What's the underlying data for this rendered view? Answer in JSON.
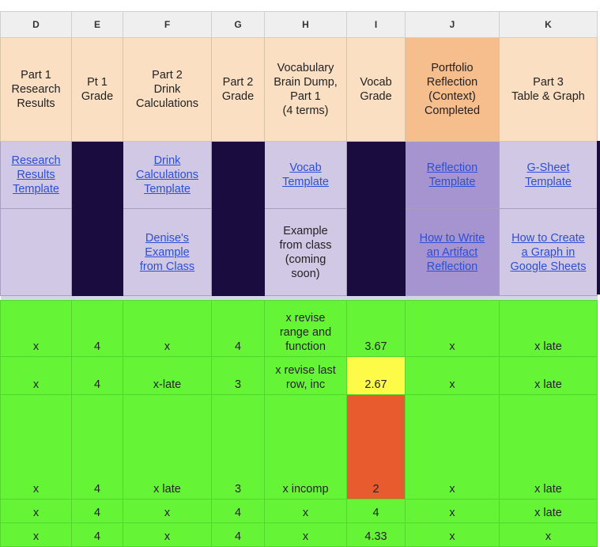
{
  "columns": [
    "D",
    "E",
    "F",
    "G",
    "H",
    "I",
    "J",
    "K"
  ],
  "headers": [
    [
      "Part 1",
      "Research",
      "Results"
    ],
    [
      "Pt 1",
      "Grade"
    ],
    [
      "Part 2",
      "Drink",
      "Calculations"
    ],
    [
      "Part 2",
      "Grade"
    ],
    [
      "Vocabulary",
      "Brain Dump,",
      "Part 1",
      "(4 terms)"
    ],
    [
      "Vocab",
      "Grade"
    ],
    [
      "Portfolio",
      "Reflection",
      "(Context)",
      "Completed"
    ],
    [
      "Part 3",
      "Table & Graph"
    ]
  ],
  "links_row": [
    {
      "type": "link",
      "lines": [
        "Research",
        "Results",
        "Template"
      ]
    },
    {
      "type": "blank"
    },
    {
      "type": "link",
      "lines": [
        "Drink",
        "Calculations",
        "Template"
      ]
    },
    {
      "type": "blank"
    },
    {
      "type": "link",
      "lines": [
        "Vocab",
        "Template"
      ]
    },
    {
      "type": "blank"
    },
    {
      "type": "link",
      "lines": [
        "Reflection",
        "Template"
      ]
    },
    {
      "type": "link",
      "lines": [
        "G-Sheet",
        "Template"
      ]
    }
  ],
  "example_row": [
    {
      "type": "empty"
    },
    {
      "type": "blank"
    },
    {
      "type": "link",
      "lines": [
        "Denise's",
        "Example",
        "from Class"
      ]
    },
    {
      "type": "blank"
    },
    {
      "type": "text",
      "lines": [
        "Example",
        "from class",
        "(coming",
        "soon)"
      ]
    },
    {
      "type": "blank"
    },
    {
      "type": "link",
      "lines": [
        "How to Write",
        "an Artifact",
        "Reflection"
      ]
    },
    {
      "type": "link",
      "lines": [
        "How to Create",
        "a Graph in",
        "Google Sheets"
      ]
    }
  ],
  "data_rows": [
    [
      [
        "x"
      ],
      [
        "4"
      ],
      [
        "x"
      ],
      [
        "4"
      ],
      [
        "x revise",
        "range and",
        "function"
      ],
      [
        "3.67"
      ],
      [
        "x"
      ],
      [
        "x late"
      ]
    ],
    [
      [
        "x"
      ],
      [
        "4"
      ],
      [
        "x-late"
      ],
      [
        "3"
      ],
      [
        "x revise last",
        "row, inc"
      ],
      [
        "2.67"
      ],
      [
        "x"
      ],
      [
        "x late"
      ]
    ],
    [
      [
        "x"
      ],
      [
        "4"
      ],
      [
        "x late"
      ],
      [
        "3"
      ],
      [
        "x incomp"
      ],
      [
        "2"
      ],
      [
        "x"
      ],
      [
        "x late"
      ]
    ],
    [
      [
        "x"
      ],
      [
        "4"
      ],
      [
        "x"
      ],
      [
        "4"
      ],
      [
        "x"
      ],
      [
        "4"
      ],
      [
        "x"
      ],
      [
        "x late"
      ]
    ],
    [
      [
        "x"
      ],
      [
        "4"
      ],
      [
        "x"
      ],
      [
        "4"
      ],
      [
        "x"
      ],
      [
        "4.33"
      ],
      [
        "x"
      ],
      [
        "x"
      ]
    ]
  ],
  "vocab_grade_highlights": {
    "row_2": "yellow",
    "row_3": "orange"
  },
  "colors": {
    "header_bg": "#fbdfc3",
    "header_highlight": "#f6bd8d",
    "link_row_bg": "#d1c8e6",
    "link_row_highlight": "#a594cf",
    "blank_dark": "#1a0c3e",
    "data_green": "#66f536",
    "warn_yellow": "#fdfb48",
    "fail_orange": "#e85b2f",
    "link_blue": "#2b4fd8"
  }
}
